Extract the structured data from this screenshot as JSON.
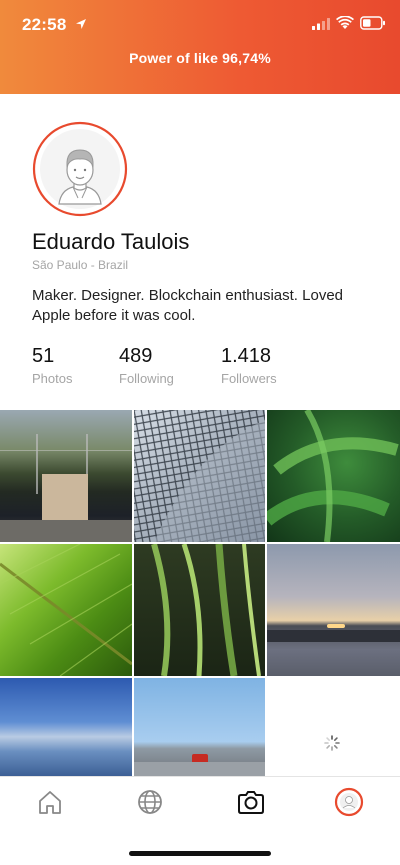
{
  "status_bar": {
    "time": "22:58"
  },
  "header": {
    "power_text": "Power of like 96,74%",
    "power_percent": 96.74
  },
  "profile": {
    "name": "Eduardo Taulois",
    "location": "São Paulo - Brazil",
    "bio": "Maker. Designer. Blockchain enthusiast. Loved Apple before it was cool.",
    "stats": [
      {
        "value": "51",
        "label": "Photos"
      },
      {
        "value": "489",
        "label": "Following"
      },
      {
        "value": "1.418",
        "label": "Followers"
      }
    ]
  },
  "colors": {
    "accent": "#e84a2e",
    "header_start": "#f08a3c",
    "header_end": "#e84a2e"
  },
  "tabbar": {
    "items": [
      "home-icon",
      "globe-icon",
      "camera-icon",
      "profile-ring-icon"
    ]
  }
}
